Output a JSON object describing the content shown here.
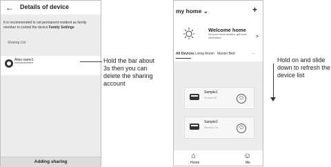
{
  "left_phone": {
    "title": "Details of device",
    "back_icon": "back-arrow-icon",
    "info_prefix": "It is recommended to set permanent resident as family member to control the device",
    "info_link": "Family Settings",
    "sharing_list_label": "Sharing List",
    "shared_account": {
      "name": "Alias name1",
      "account": "************"
    },
    "add_button": "Adding sharing"
  },
  "annotation_left": "Hold the bar about 3s then you can delete the sharing account",
  "right_phone": {
    "home_selector": "my home",
    "add_icon": "plus-icon",
    "welcome_title": "Welcome home",
    "welcome_sub": "Set your home location, get more information",
    "tabs": [
      "All Devices",
      "Living Room",
      "Master Bed",
      "···"
    ],
    "devices": [
      {
        "name": "Sample1",
        "status": "Turned off"
      },
      {
        "name": "Sample2",
        "status": "Already On"
      }
    ],
    "nav": [
      {
        "label": "Home",
        "icon": "home-icon"
      },
      {
        "label": "Me",
        "icon": "user-icon"
      }
    ]
  },
  "annotation_right": "Hold on and slide down to refresh the device list"
}
